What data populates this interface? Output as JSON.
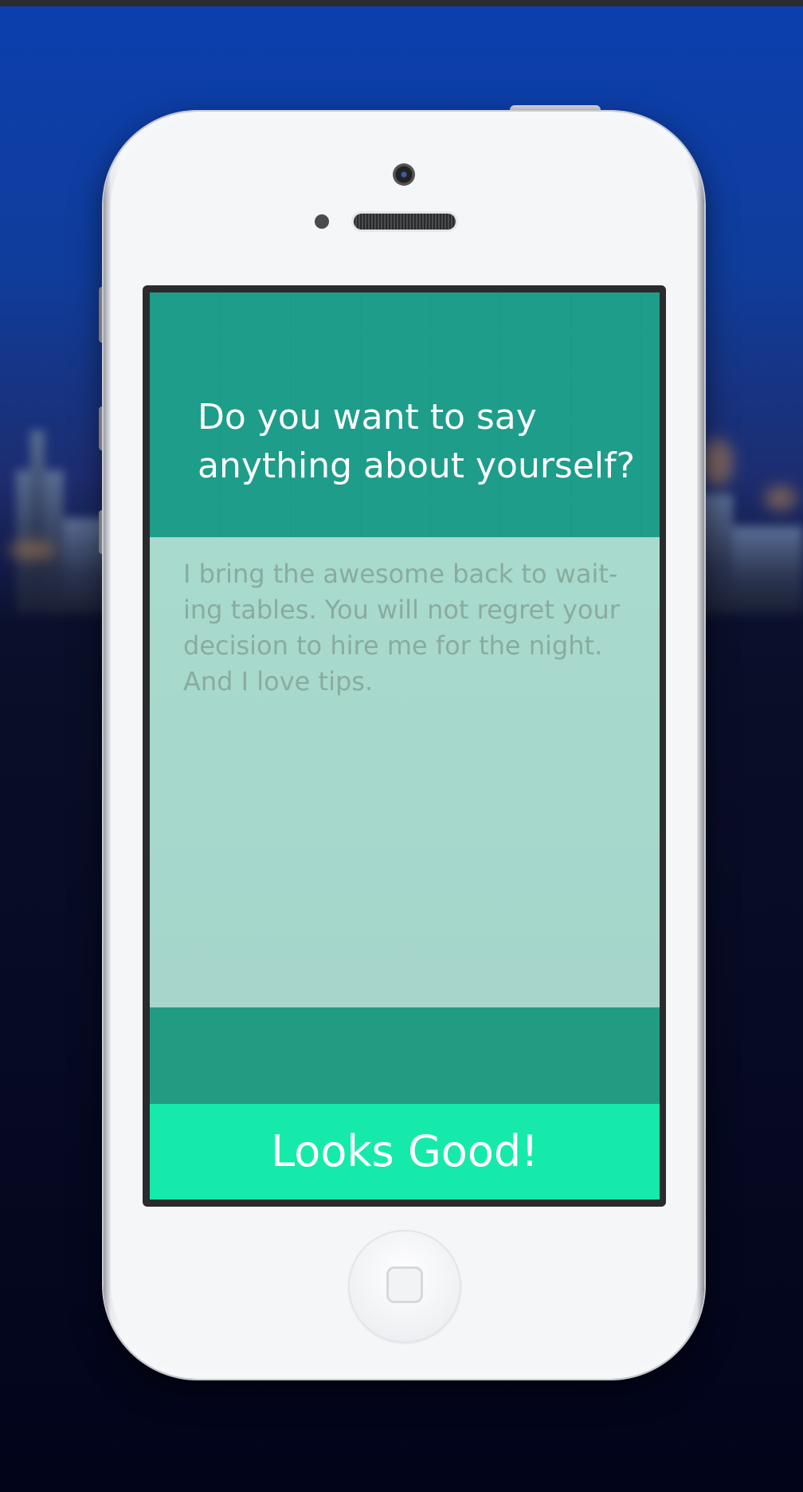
{
  "prompt": {
    "title_line1": "Do you want to say",
    "title_line2": "anything about yourself?"
  },
  "about": {
    "text": "I bring the awesome back to wait-ing tables.  You will not regret your decision to hire me for the night. And I love tips."
  },
  "actions": {
    "confirm_label": "Looks Good!"
  },
  "colors": {
    "header": "#1e9d8a",
    "text_area": "#a8dacd",
    "button": "#16eaaa",
    "background_top": "#0c3fae",
    "background_bottom": "#02041a"
  },
  "icons": [
    "camera-icon",
    "home-button-icon"
  ]
}
